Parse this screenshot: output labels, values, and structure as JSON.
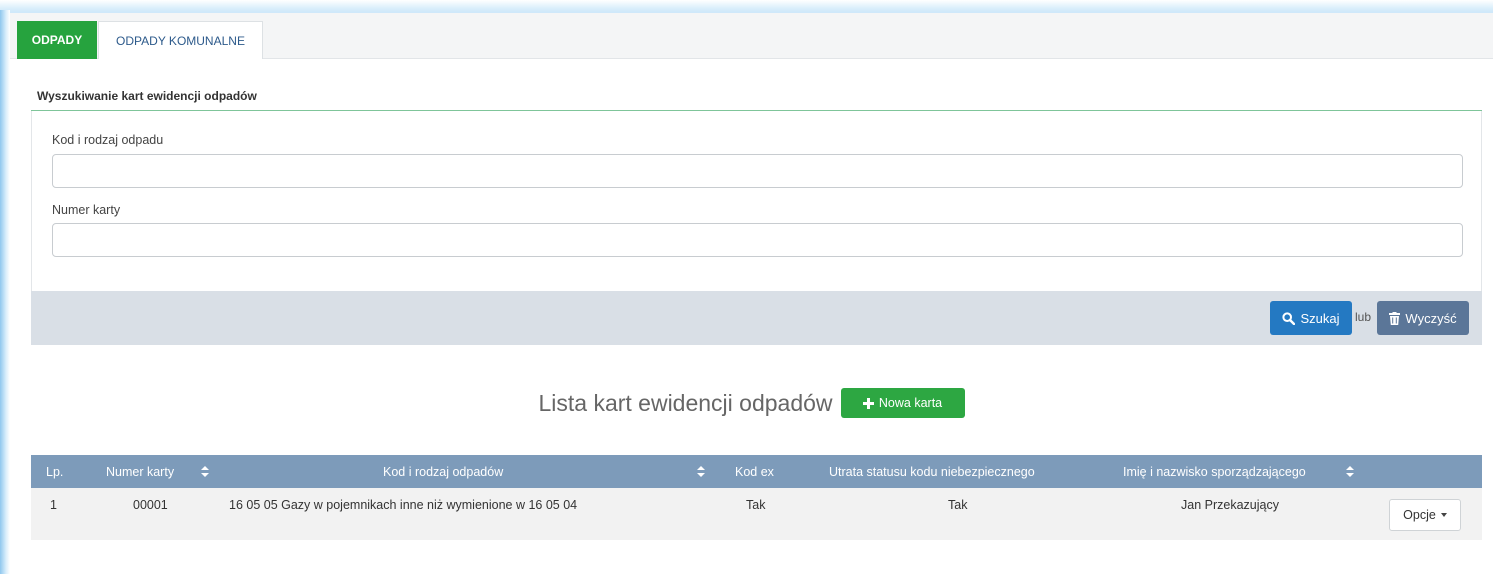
{
  "tabs": [
    {
      "label": "ODPADY",
      "active": true
    },
    {
      "label": "ODPADY KOMUNALNE",
      "active": false
    }
  ],
  "search": {
    "title": "Wyszukiwanie kart ewidencji odpadów",
    "fields": [
      {
        "label": "Kod i rodzaj odpadu",
        "value": ""
      },
      {
        "label": "Numer karty",
        "value": ""
      }
    ],
    "search_button": "Szukaj",
    "or_text": "lub",
    "clear_button": "Wyczyść"
  },
  "list": {
    "title": "Lista kart ewidencji odpadów",
    "new_button": "Nowa karta",
    "columns": [
      "Lp.",
      "Numer karty",
      "Kod i rodzaj odpadów",
      "Kod ex",
      "Utrata statusu kodu niebezpiecznego",
      "Imię i nazwisko sporządzającego"
    ],
    "rows": [
      {
        "lp": "1",
        "numer": "00001",
        "kod_rodzaj": "16 05 05 Gazy w pojemnikach inne niż wymienione w 16 05 04",
        "kod_ex": "Tak",
        "utrata": "Tak",
        "imie": "Jan Przekazujący",
        "options": "Opcje"
      }
    ]
  },
  "colors": {
    "active_tab": "#26a33e",
    "search_button": "#2479c2",
    "clear_button": "#5b7698",
    "new_button": "#2da742",
    "table_header": "#7d9bba"
  }
}
